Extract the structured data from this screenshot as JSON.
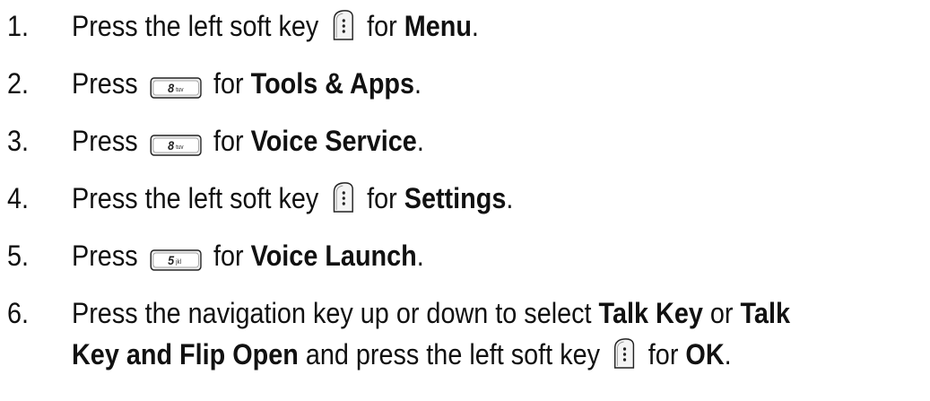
{
  "steps": [
    {
      "number": "1.",
      "pre": "Press the left soft key",
      "key_icon": "left-soft-key",
      "mid": "for",
      "bold": "Menu",
      "end": "."
    },
    {
      "number": "2.",
      "pre": "Press",
      "key_icon": "8-tuv-key",
      "key_digit": "8",
      "key_letters": "tuv",
      "mid": "for",
      "bold": "Tools & Apps",
      "end": "."
    },
    {
      "number": "3.",
      "pre": "Press",
      "key_icon": "8-tuv-key",
      "key_digit": "8",
      "key_letters": "tuv",
      "mid": "for",
      "bold": "Voice Service",
      "end": "."
    },
    {
      "number": "4.",
      "pre": "Press the left soft key",
      "key_icon": "left-soft-key",
      "mid": "for",
      "bold": "Settings",
      "end": "."
    },
    {
      "number": "5.",
      "pre": "Press",
      "key_icon": "5-jkl-key",
      "key_digit": "5",
      "key_letters": "jkl",
      "mid": "for",
      "bold": "Voice Launch",
      "end": "."
    },
    {
      "number": "6.",
      "pre": "Press the navigation key up or down to select",
      "bold1": "Talk Key",
      "or": "or",
      "bold2": "Talk Key and Flip Open",
      "and": "and press the left soft key",
      "key_icon": "left-soft-key",
      "mid": "for",
      "bold3": "OK",
      "end": "."
    }
  ]
}
